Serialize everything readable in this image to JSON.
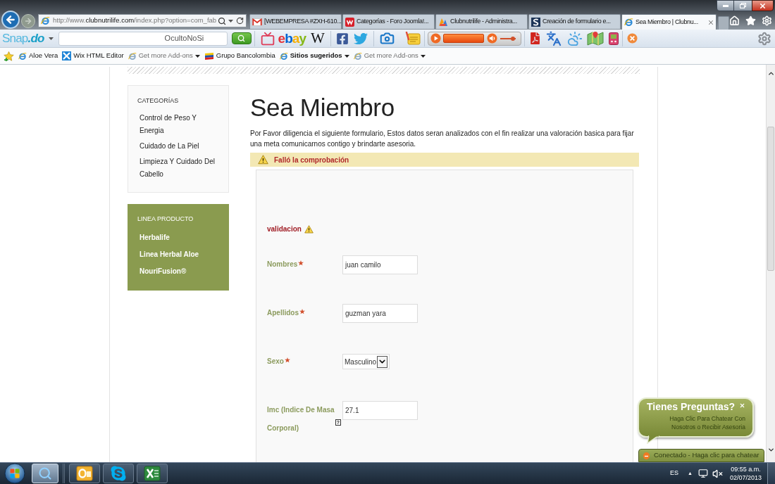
{
  "browser": {
    "navigation": {
      "back_disabled": false,
      "forward_disabled": true
    },
    "address": {
      "scheme": "http://www.",
      "domain": "clubnutrilife.com",
      "path": "/index.php?option=com_fab"
    },
    "tabs": [
      {
        "kind": "mail",
        "title": "[WEBEMPRESA #ZXH-610...",
        "selected": false
      },
      {
        "kind": "forum",
        "title": "Categorías - Foro Joomla!...",
        "selected": false
      },
      {
        "kind": "admin",
        "title": "Clubnutrilife - Administra...",
        "selected": false
      },
      {
        "kind": "letter",
        "title": "Creación de formulario e...",
        "selected": false
      },
      {
        "kind": "page",
        "title": "Sea Miembro | Clubnu...",
        "selected": true
      }
    ]
  },
  "toolbar": {
    "logo": [
      "Snap",
      ".do"
    ],
    "search_value": "OcultoNoSi",
    "shop_logo": "ebay",
    "wiki_letter": "W",
    "volume_slider": {
      "level": 0.85
    }
  },
  "favorites": [
    {
      "kind": "page",
      "label": "Aloe Vera"
    },
    {
      "kind": "wix",
      "label": "Wix HTML Editor"
    },
    {
      "kind": "addons",
      "label": "Get more Add-ons"
    },
    {
      "kind": "bank",
      "label": "Grupo Bancolombia"
    },
    {
      "kind": "menu",
      "label": "Sitios sugeridos"
    },
    {
      "kind": "addons",
      "label": "Get more Add-ons"
    }
  ],
  "page": {
    "categories": {
      "title": "CATEGORÍAS",
      "items": [
        "Control de Peso Y Energia",
        "Cuidado de La Piel",
        "Limpieza Y Cuidado Del Cabello"
      ]
    },
    "products": {
      "title": "LINEA PRODUCTO",
      "items": [
        "Herbalife",
        "Linea Herbal Aloe",
        "NouriFusion®"
      ]
    },
    "title": "Sea Miembro",
    "intro": "Por Favor diligencia el siguiente formulario, Estos datos seran analizados con el fin realizar una valoración basica para fijar una meta comunicarnos contigo y brindarte asesoria.",
    "alert": "Falló la comprobación",
    "form": [
      {
        "kind": "error",
        "label": "validacion"
      },
      {
        "kind": "text",
        "label": "Nombres",
        "required": true,
        "value": "juan camilo"
      },
      {
        "kind": "text",
        "label": "Apellidos",
        "required": true,
        "value": "guzman yara"
      },
      {
        "kind": "select",
        "label": "Sexo",
        "required": true,
        "value": "Masculino"
      },
      {
        "kind": "text",
        "label": "Imc (Indice De Masa Corporal)",
        "required": false,
        "help": "?",
        "value": "27.1"
      }
    ]
  },
  "chat": {
    "title": "Tienes Preguntas?",
    "subtitle": "Haga Clic Para Chatear Con Nosotros o Recibir Asesoria",
    "status": "Conectado - Haga clic para chatear"
  },
  "taskbar": {
    "apps": [
      {
        "kind": "search",
        "highlighted": true
      },
      {
        "kind": "outlook",
        "highlighted": false
      },
      {
        "kind": "skype",
        "highlighted": false
      },
      {
        "kind": "spreadsheet",
        "highlighted": false
      }
    ],
    "language": "ES",
    "tray_toggle": "▲",
    "time": "09:55 a.m.",
    "date": "02/07/2013"
  }
}
